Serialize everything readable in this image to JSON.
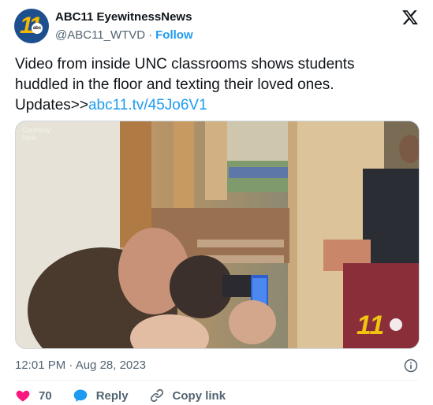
{
  "account": {
    "name": "ABC11 EyewitnessNews",
    "handle": "@ABC11_WTVD",
    "separator": "·",
    "follow_label": "Follow",
    "avatar_num": "11",
    "avatar_badge": "abc"
  },
  "tweet": {
    "text_line1": "Video from inside UNC classrooms shows students",
    "text_line2": "huddled in the floor and texting their loved ones.",
    "text_prefix": "Updates>>",
    "link": "abc11.tv/45Jo6V1"
  },
  "media": {
    "watermark": "Courtesy Nick",
    "corner_logo": "11",
    "corner_badge": "abc"
  },
  "meta": {
    "timestamp": "12:01 PM · Aug 28, 2023"
  },
  "actions": {
    "likes": "70",
    "reply_label": "Reply",
    "copy_link_label": "Copy link"
  },
  "colors": {
    "accent": "#1d9bf0",
    "like": "#f91880",
    "muted": "#536471",
    "text": "#0f1419"
  },
  "icons": [
    "x-logo-icon",
    "info-icon",
    "heart-icon",
    "reply-bubble-icon",
    "link-icon"
  ]
}
